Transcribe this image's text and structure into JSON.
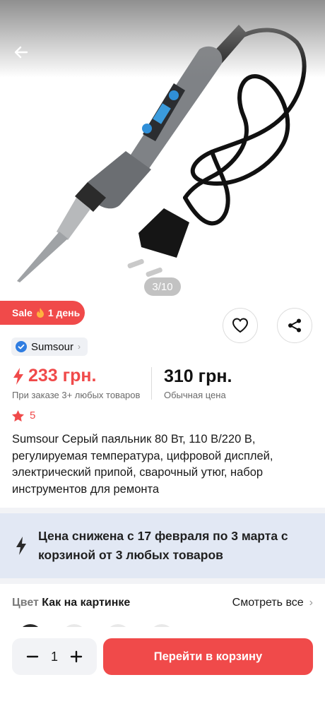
{
  "gallery": {
    "image_alt": "Soldering iron with digital display",
    "counter": "3/10",
    "back_icon": "arrow-left-icon"
  },
  "badge": {
    "sale_label": "Sale",
    "sale_icon": "fire-icon",
    "duration": "1 день"
  },
  "actions": {
    "favorite_icon": "heart-icon",
    "share_icon": "share-icon"
  },
  "brand": {
    "name": "Sumsour",
    "verified_icon": "verified-check-icon"
  },
  "price": {
    "current": "233 грн.",
    "current_note": "При заказе 3+ любых товаров",
    "regular": "310 грн.",
    "regular_note": "Обычная цена",
    "accent_color": "#f04a4a"
  },
  "rating": {
    "value": "5"
  },
  "product": {
    "title": "Sumsour Серый паяльник 80 Вт, 110 В/220 В, регулируемая температура, цифровой дисплей, электрический припой, сварочный утюг, набор инструментов для ремонта"
  },
  "promo": {
    "text": "Цена снижена с 17 февраля по 3 марта с корзиной от 3 любых товаров",
    "background": "#e2e8f4"
  },
  "color_option": {
    "label": "Цвет",
    "value": "Как на картинке",
    "see_all": "Смотреть все"
  },
  "bottom_bar": {
    "quantity": "1",
    "cart_button": "Перейти в корзину"
  }
}
